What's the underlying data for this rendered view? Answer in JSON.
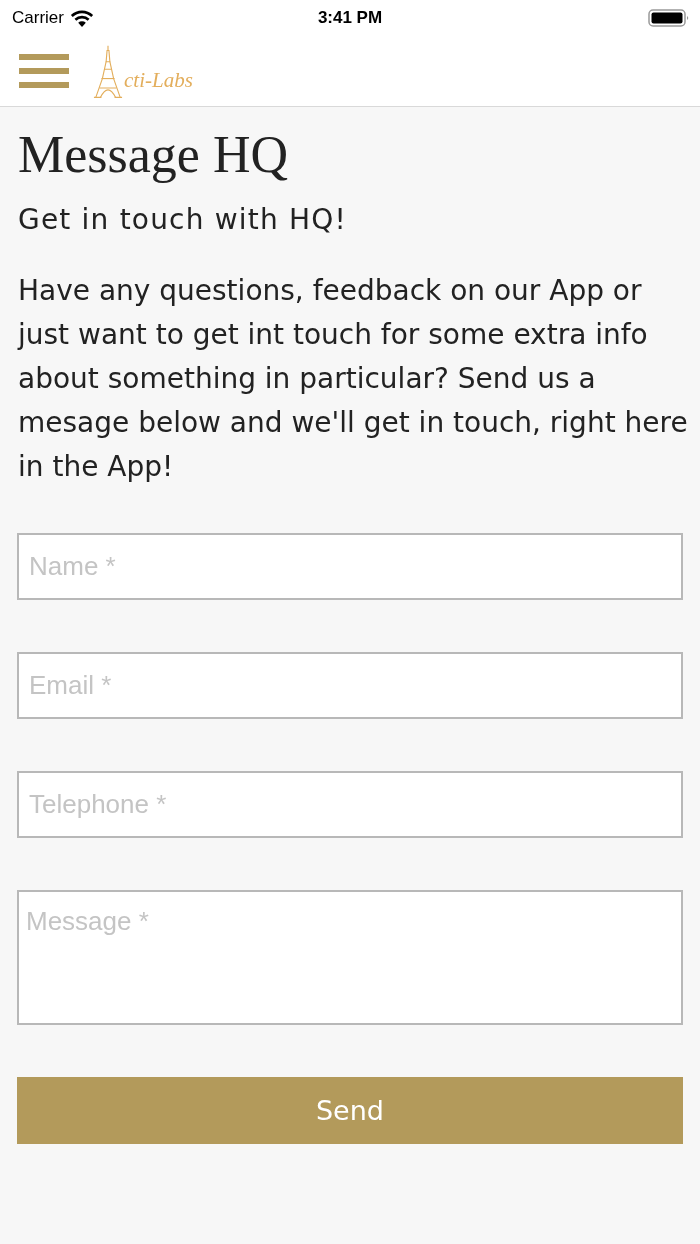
{
  "status_bar": {
    "carrier": "Carrier",
    "time": "3:41 PM"
  },
  "header": {
    "logo_text": "cti-Labs"
  },
  "page": {
    "title": "Message HQ",
    "subtitle": "Get in touch with HQ!",
    "intro": "Have any questions, feedback on our App or just want to get int touch for some extra info about something in particular? Send us a mesage below and we'll get in touch, right here in the App!"
  },
  "form": {
    "fields": [
      {
        "kind": "input",
        "placeholder": "Name *"
      },
      {
        "kind": "input",
        "placeholder": "Email *"
      },
      {
        "kind": "input",
        "placeholder": "Telephone *"
      },
      {
        "kind": "textarea",
        "placeholder": "Message *"
      }
    ],
    "submit": "Send"
  }
}
